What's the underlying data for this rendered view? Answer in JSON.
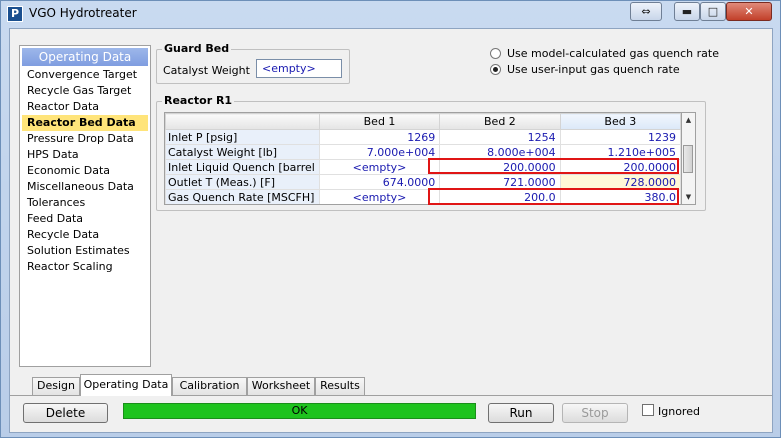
{
  "window": {
    "title": "VGO Hydrotreater",
    "app_icon": "P"
  },
  "titlebar_buttons": {
    "restore": "⇔",
    "minimize": "▬",
    "maximize": "□",
    "close": "✕"
  },
  "nav": {
    "header": "Operating Data",
    "items": [
      "Convergence Target",
      "Recycle Gas Target",
      "Reactor Data",
      "Reactor Bed Data",
      "Pressure Drop Data",
      "HPS Data",
      "Economic Data",
      "Miscellaneous Data",
      "Tolerances",
      "Feed Data",
      "Recycle Data",
      "Solution Estimates",
      "Reactor Scaling"
    ],
    "active_index": 3
  },
  "guard_bed": {
    "title": "Guard Bed",
    "catalyst_weight_label": "Catalyst Weight",
    "catalyst_weight_value": "<empty>"
  },
  "quench_options": {
    "model_calculated": "Use model-calculated gas quench rate",
    "user_input": "Use user-input gas quench rate",
    "selected": "user_input"
  },
  "reactor": {
    "title": "Reactor R1",
    "columns": [
      "Bed 1",
      "Bed 2",
      "Bed 3"
    ],
    "rows": [
      {
        "label": "Inlet P [psig]",
        "values": [
          "1269",
          "1254",
          "1239"
        ]
      },
      {
        "label": "Catalyst Weight [lb]",
        "values": [
          "7.000e+004",
          "8.000e+004",
          "1.210e+005"
        ]
      },
      {
        "label": "Inlet Liquid Quench [barrel",
        "values": [
          "<empty>",
          "200.0000",
          "200.0000"
        ]
      },
      {
        "label": "Outlet T (Meas.) [F]",
        "values": [
          "674.0000",
          "721.0000",
          "728.0000"
        ]
      },
      {
        "label": "Gas Quench Rate [MSCFH]",
        "values": [
          "<empty>",
          "200.0",
          "380.0"
        ]
      }
    ]
  },
  "tabs": [
    "Design",
    "Operating Data",
    "Calibration",
    "Worksheet",
    "Results"
  ],
  "active_tab": "Operating Data",
  "footer": {
    "delete": "Delete",
    "status": "OK",
    "run": "Run",
    "stop": "Stop",
    "ignored": "Ignored",
    "status_color": "#1ec31e"
  }
}
